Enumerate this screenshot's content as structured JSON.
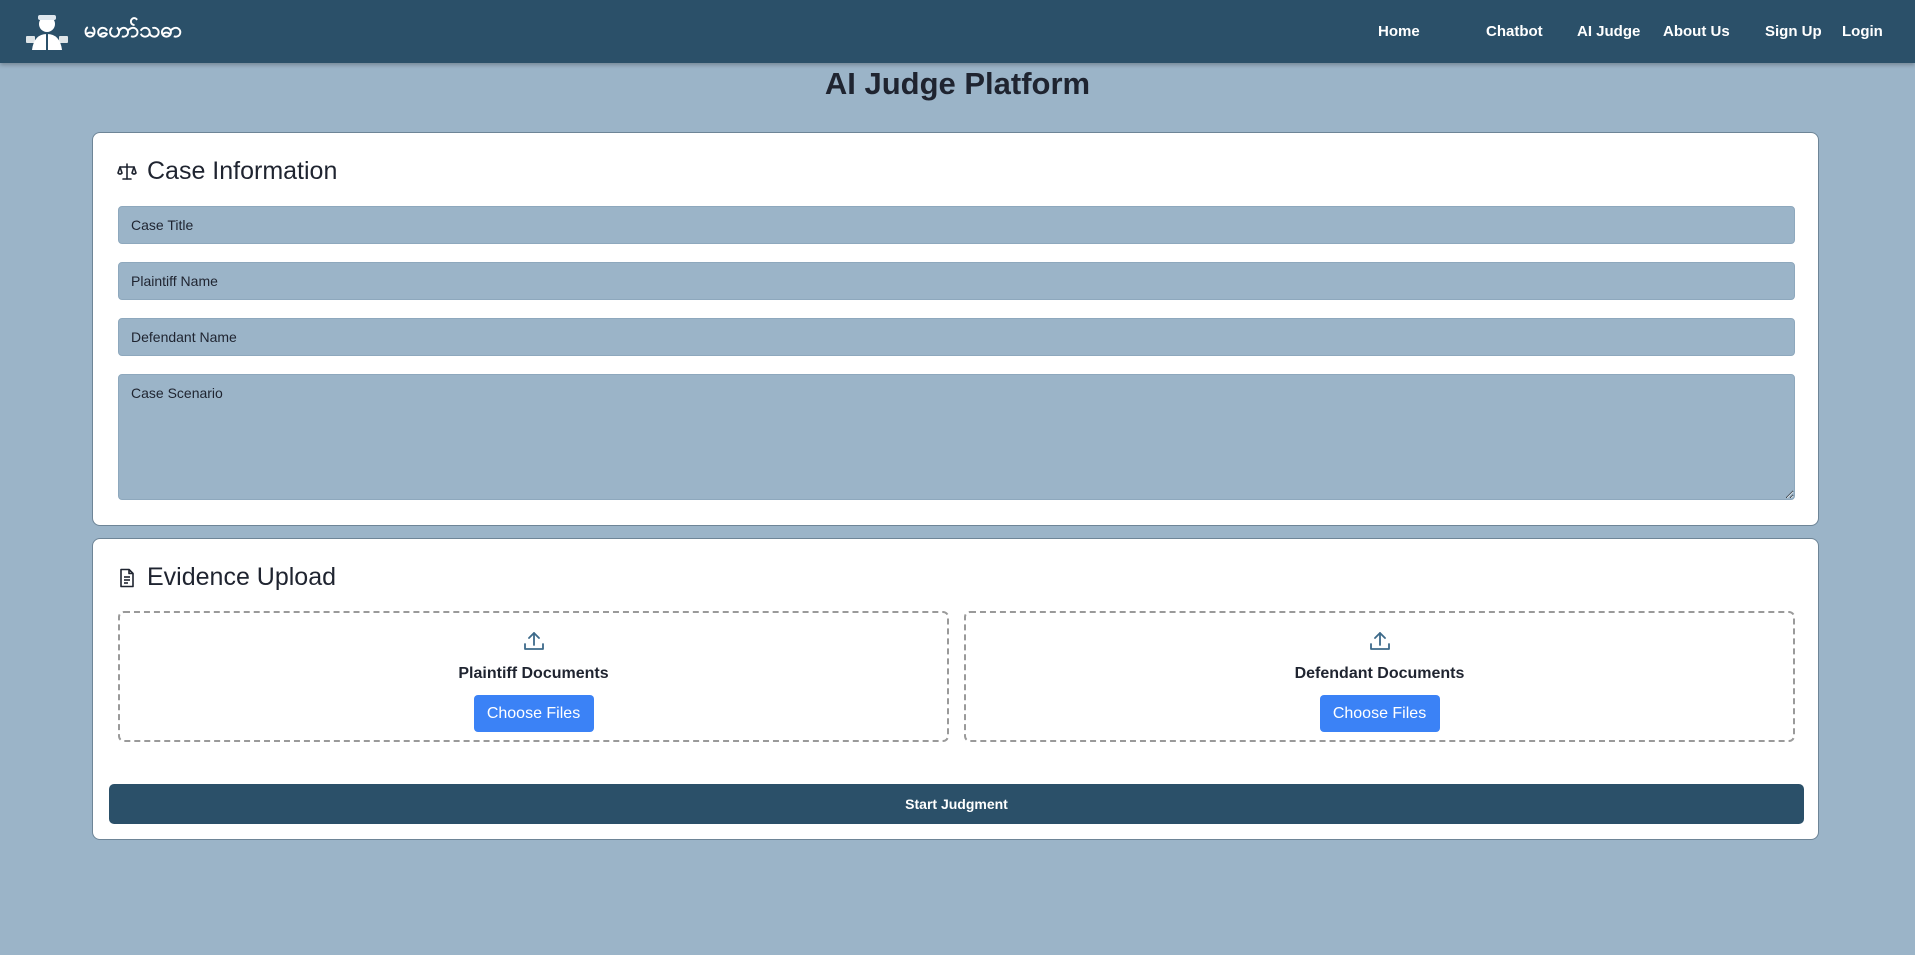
{
  "brand": {
    "name": "မဟော်သဓာ",
    "logo_icon": "judge-avatar-icon"
  },
  "nav": {
    "items": [
      {
        "label": "Home"
      },
      {
        "label": "Chatbot"
      },
      {
        "label": "AI Judge"
      },
      {
        "label": "About Us"
      },
      {
        "label": "Sign Up"
      },
      {
        "label": "Login"
      }
    ]
  },
  "page": {
    "title": "AI Judge Platform"
  },
  "case_info": {
    "heading": "Case Information",
    "icon": "scales-icon",
    "case_title": {
      "placeholder": "Case Title",
      "value": ""
    },
    "plaintiff_name": {
      "placeholder": "Plaintiff Name",
      "value": ""
    },
    "defendant_name": {
      "placeholder": "Defendant Name",
      "value": ""
    },
    "case_scenario": {
      "placeholder": "Case Scenario",
      "value": ""
    }
  },
  "evidence": {
    "heading": "Evidence Upload",
    "icon": "document-icon",
    "plaintiff": {
      "label": "Plaintiff Documents",
      "button": "Choose Files",
      "icon": "upload-icon"
    },
    "defendant": {
      "label": "Defendant Documents",
      "button": "Choose Files",
      "icon": "upload-icon"
    },
    "submit_label": "Start Judgment"
  },
  "colors": {
    "navbar": "#2b5069",
    "background": "#9bb4c8",
    "primary_button": "#3b82f6",
    "submit_button": "#2b5069"
  }
}
